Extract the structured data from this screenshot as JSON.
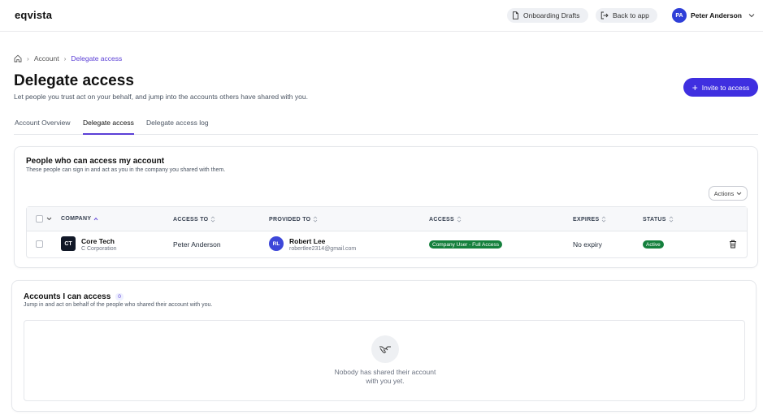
{
  "app": {
    "logo": "eqvista"
  },
  "header": {
    "drafts_label": "Onboarding Drafts",
    "back_label": "Back to app",
    "user_initials": "PA",
    "user_name": "Peter Anderson"
  },
  "breadcrumb": {
    "items": [
      "Account",
      "Delegate access"
    ]
  },
  "page": {
    "title": "Delegate access",
    "subtitle": "Let people you trust act on your behalf, and jump into the accounts others have shared with you.",
    "invite_label": "Invite to access"
  },
  "tabs": [
    "Account Overview",
    "Delegate access",
    "Delegate access log"
  ],
  "my_access": {
    "title": "People who can access my account",
    "subtitle": "These people can sign in and act as you in the company you shared with them.",
    "actions_label": "Actions",
    "columns": [
      "COMPANY",
      "ACCESS TO",
      "PROVIDED TO",
      "ACCESS",
      "EXPIRES",
      "STATUS"
    ],
    "rows": [
      {
        "company_initials": "CT",
        "company_name": "Core Tech",
        "company_type": "C Corporation",
        "access_to": "Peter Anderson",
        "provided_initials": "RL",
        "provided_name": "Robert Lee",
        "provided_email": "robertlee2314@gmail.com",
        "access": "Company User - Full Access",
        "expires": "No expiry",
        "status": "Active"
      }
    ]
  },
  "accounts_i_access": {
    "title": "Accounts I can access",
    "count": "0",
    "subtitle": "Jump in and act on behalf of the people who shared their account with you.",
    "empty_line1": "Nobody has shared their account",
    "empty_line2": "with you yet."
  },
  "colors": {
    "accent": "#5b3fd6",
    "primary_button": "#3f2fe0",
    "success": "#15803d"
  }
}
